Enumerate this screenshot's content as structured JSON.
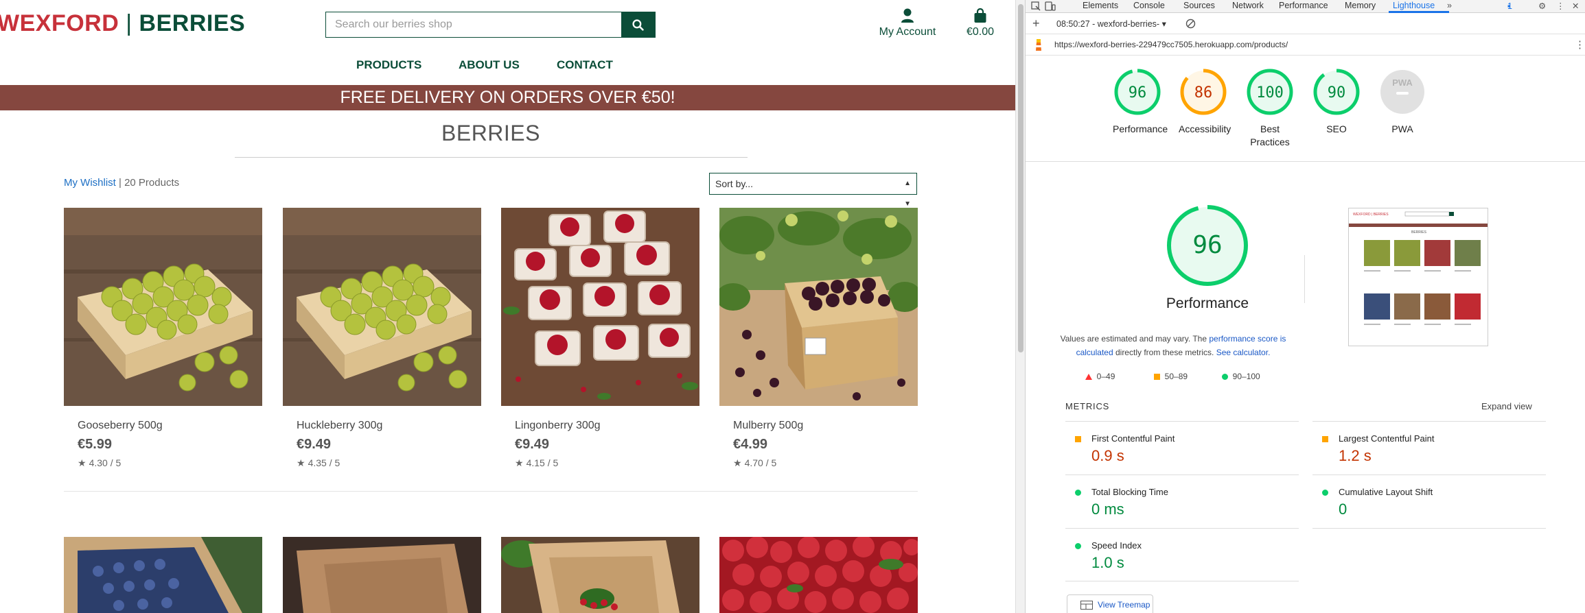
{
  "site": {
    "logo_left": "WEXFORD",
    "logo_sep": "|",
    "logo_right": "BERRIES",
    "search_placeholder": "Search our berries shop",
    "account_label": "My Account",
    "cart_total": "€0.00",
    "nav": [
      "PRODUCTS",
      "ABOUT US",
      "CONTACT"
    ],
    "banner": "FREE DELIVERY ON ORDERS OVER €50!",
    "page_title": "BERRIES",
    "wishlist_link": "My Wishlist",
    "product_count": "| 20 Products",
    "sort_label": "Sort by...",
    "products": [
      {
        "name": "Gooseberry 500g",
        "price": "€5.99",
        "rating": "4.30 / 5"
      },
      {
        "name": "Huckleberry 300g",
        "price": "€9.49",
        "rating": "4.35 / 5"
      },
      {
        "name": "Lingonberry 300g",
        "price": "€9.49",
        "rating": "4.15 / 5"
      },
      {
        "name": "Mulberry 500g",
        "price": "€4.99",
        "rating": "4.70 / 5"
      }
    ],
    "colors": {
      "brand_green": "#0b4d38",
      "brand_red": "#c7313a",
      "banner": "#85473f"
    }
  },
  "devtools": {
    "tabs": [
      "Elements",
      "Console",
      "Sources",
      "Network",
      "Performance",
      "Memory",
      "Lighthouse"
    ],
    "active_tab": "Lighthouse",
    "badge_count": "1",
    "report_time": "08:50:27 - wexford-berries-",
    "url": "https://wexford-berries-229479cc7505.herokuapp.com/products/",
    "scores": [
      {
        "value": "96",
        "label": "Performance",
        "color": "#0cce6b"
      },
      {
        "value": "86",
        "label": "Accessibility",
        "color": "#ffa400"
      },
      {
        "value": "100",
        "label": "Best Practices",
        "color": "#0cce6b"
      },
      {
        "value": "90",
        "label": "SEO",
        "color": "#0cce6b"
      },
      {
        "value": "PWA",
        "label": "PWA",
        "color": "#9e9e9e"
      }
    ],
    "perf_score": "96",
    "perf_title": "Performance",
    "perf_desc_1": "Values are estimated and may vary. The ",
    "perf_desc_link": "performance score is calculated",
    "perf_desc_2": " directly from these metrics. ",
    "perf_desc_calc": "See calculator.",
    "legend": [
      "0–49",
      "50–89",
      "90–100"
    ],
    "metrics_heading": "METRICS",
    "expand_label": "Expand view",
    "metrics": [
      {
        "label": "First Contentful Paint",
        "value": "0.9 s",
        "status": "average"
      },
      {
        "label": "Largest Contentful Paint",
        "value": "1.2 s",
        "status": "average"
      },
      {
        "label": "Total Blocking Time",
        "value": "0 ms",
        "status": "pass"
      },
      {
        "label": "Cumulative Layout Shift",
        "value": "0",
        "status": "pass"
      },
      {
        "label": "Speed Index",
        "value": "1.0 s",
        "status": "pass"
      }
    ],
    "treemap_label": "View Treemap",
    "thumb": {
      "logo": "WEXFORD | BERRIES",
      "title": "BERRIES"
    }
  }
}
